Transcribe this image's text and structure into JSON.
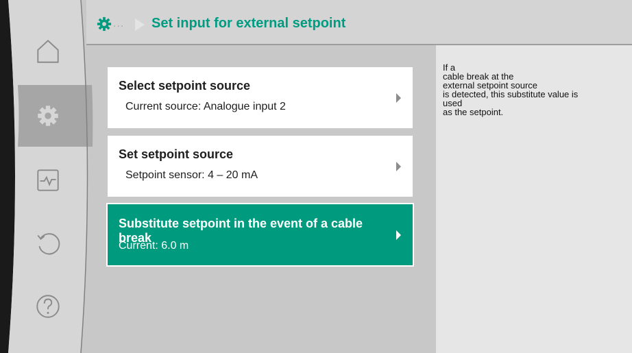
{
  "header": {
    "title": "Set input for external setpoint",
    "breadcrumb_ellipsis": "..."
  },
  "nav": [
    {
      "icon": "home-icon"
    },
    {
      "icon": "gear-icon"
    },
    {
      "icon": "diagnostics-icon"
    },
    {
      "icon": "restore-icon"
    },
    {
      "icon": "help-icon"
    }
  ],
  "menu": {
    "items": [
      {
        "title": "Select setpoint source",
        "subtitle": "Current source: Analogue input 2"
      },
      {
        "title": "Set setpoint source",
        "subtitle": "Setpoint sensor: 4 – 20 mA"
      },
      {
        "title": "Substitute setpoint in the event of a cable break",
        "subtitle": "Current: 6.0 m"
      }
    ]
  },
  "help": {
    "text": "If a\ncable break at the\nexternal setpoint source\nis detected, this substitute value is\nused\nas the setpoint."
  },
  "colors": {
    "accent": "#009a7e",
    "sidebar": "#d6d6d6",
    "sidebar_active": "#a6a6a6",
    "help_panel": "#e6e6e6",
    "content_bg": "#c8c8c8"
  }
}
